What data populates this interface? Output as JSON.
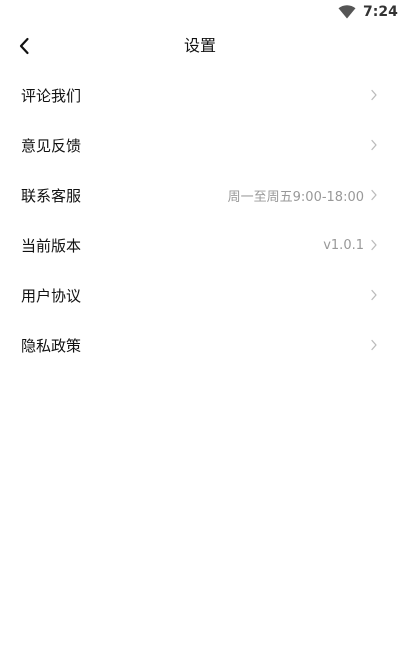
{
  "status_bar": {
    "time": "7:24",
    "wifi_icon": "wifi-icon"
  },
  "app_bar": {
    "back_icon": "chevron-left-icon",
    "title": "设置"
  },
  "menu": {
    "items": [
      {
        "label": "评论我们",
        "value": ""
      },
      {
        "label": "意见反馈",
        "value": ""
      },
      {
        "label": "联系客服",
        "value": "周一至周五9:00-18:00"
      },
      {
        "label": "当前版本",
        "value": "v1.0.1"
      },
      {
        "label": "用户协议",
        "value": ""
      },
      {
        "label": "隐私政策",
        "value": ""
      }
    ],
    "chevron_icon": "chevron-right-icon"
  },
  "colors": {
    "background": "#ffffff",
    "primary_text": "#111111",
    "secondary_text": "#999999",
    "chevron": "#bbbbbb"
  }
}
